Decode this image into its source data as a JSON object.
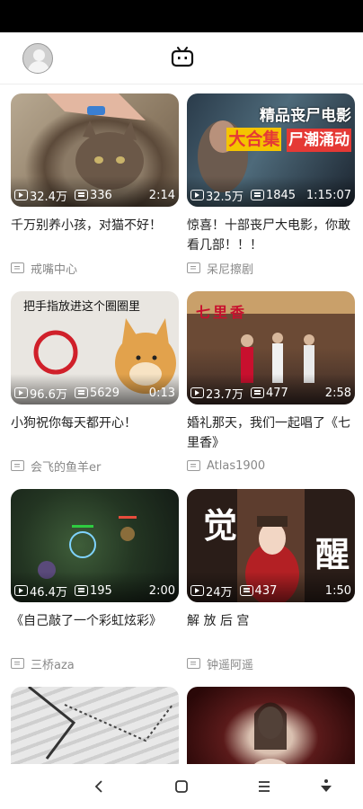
{
  "header": {
    "avatar_icon": "user-avatar",
    "center_icon": "tv-icon"
  },
  "videos": [
    {
      "views": "32.4万",
      "danmaku": "336",
      "duration": "2:14",
      "title": "千万别养小孩，对猫不好！",
      "author": "戒嘴中心",
      "thumb_text": ""
    },
    {
      "views": "32.5万",
      "danmaku": "1845",
      "duration": "1:15:07",
      "title": "惊喜！十部丧尸大电影，你敢看几部！！！",
      "author": "呆尼擦剧",
      "thumb_text": [
        "精品丧尸电影",
        "大合集",
        "尸潮涌动"
      ]
    },
    {
      "views": "96.6万",
      "danmaku": "5629",
      "duration": "0:13",
      "title": "小狗祝你每天都开心！",
      "author": "会飞的鱼羊er",
      "thumb_text": "把手指放进这个圈圈里"
    },
    {
      "views": "23.7万",
      "danmaku": "477",
      "duration": "2:58",
      "title": "婚礼那天，我们一起唱了《七里香》",
      "author": "Atlas1900",
      "thumb_text": "七里香"
    },
    {
      "views": "46.4万",
      "danmaku": "195",
      "duration": "2:00",
      "title": "《自己敲了一个彩虹炫彩》",
      "author": "三桥aza",
      "thumb_text": ""
    },
    {
      "views": "24万",
      "danmaku": "437",
      "duration": "1:50",
      "title": "解 放 后 宫",
      "author": "钟遥阿遥",
      "thumb_text": [
        "觉",
        "醒"
      ]
    },
    {
      "views": "",
      "danmaku": "",
      "duration": "",
      "title": "",
      "author": "",
      "thumb_text": ""
    },
    {
      "views": "",
      "danmaku": "",
      "duration": "",
      "title": "",
      "author": "",
      "thumb_text": ""
    }
  ],
  "nav": {
    "back": "‹",
    "home": "",
    "menu": "≡",
    "down": ""
  },
  "colors": {
    "status_bar": "#000000",
    "accent_red": "#c8102e"
  }
}
